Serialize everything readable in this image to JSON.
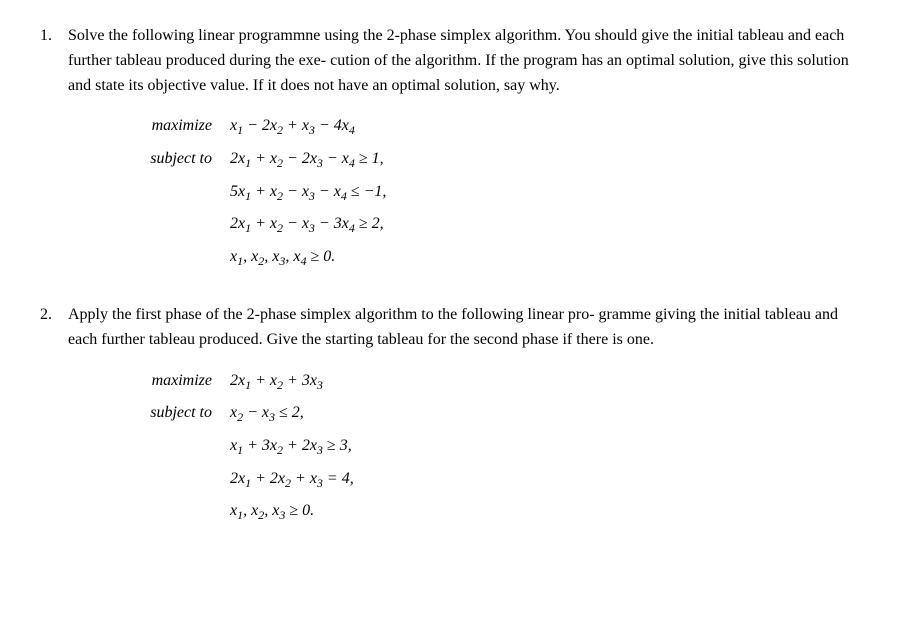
{
  "problems": [
    {
      "number": "1.",
      "description": "Solve the following linear programmne using the 2-phase simplex algorithm. You should give the initial tableau and each further tableau produced during the execution of the algorithm. If the program has an optimal solution, give this solution and state its objective value. If it does not have an optimal solution, say why.",
      "maximize_label": "maximize",
      "maximize_expr": "x₁ − 2x₂ + x₃ − 4x₄",
      "subject_label": "subject to",
      "constraints": [
        "2x₁ + x₂ − 2x₃ − x₄ ≥ 1,",
        "5x₁ + x₂ − x₃ − x₄ ≤ −1,",
        "2x₁ + x₂ − x₃ − 3x₄ ≥ 2,",
        "x₁, x₂, x₃, x₄ ≥ 0."
      ]
    },
    {
      "number": "2.",
      "description": "Apply the first phase of the 2-phase simplex algorithm to the following linear programme giving the initial tableau and each further tableau produced. Give the starting tableau for the second phase if there is one.",
      "maximize_label": "maximize",
      "maximize_expr": "2x₁ + x₂ + 3x₃",
      "subject_label": "subject to",
      "constraints": [
        "x₂ − x₃ ≤ 2,",
        "x₁ + 3x₂ + 2x₃ ≥ 3,",
        "2x₁ + 2x₂ + x₃ = 4,",
        "x₁, x₂, x₃ ≥ 0."
      ]
    }
  ]
}
